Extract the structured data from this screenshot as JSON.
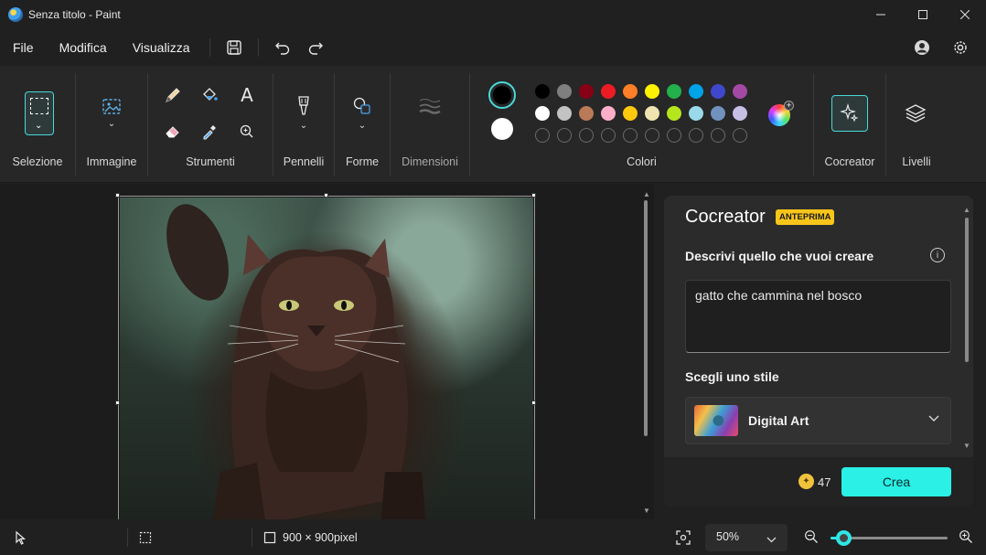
{
  "window": {
    "title": "Senza titolo - Paint"
  },
  "menu": {
    "file": "File",
    "edit": "Modifica",
    "view": "Visualizza"
  },
  "ribbon": {
    "selection_label": "Selezione",
    "image_label": "Immagine",
    "tools_label": "Strumenti",
    "brushes_label": "Pennelli",
    "shapes_label": "Forme",
    "size_label": "Dimensioni",
    "colors_label": "Colori",
    "cocreator_label": "Cocreator",
    "layers_label": "Livelli",
    "text_tool_glyph": "A"
  },
  "colors": {
    "primary": "#000000",
    "secondary": "#ffffff",
    "row1": [
      "#000000",
      "#7f7f7f",
      "#880015",
      "#ed1c24",
      "#ff7f27",
      "#fff200",
      "#22b14c",
      "#00a2e8",
      "#3f48cc",
      "#a349a4"
    ],
    "row2": [
      "#ffffff",
      "#c3c3c3",
      "#b97a57",
      "#ffaec9",
      "#ffc90e",
      "#efe4b0",
      "#b5e61d",
      "#99d9ea",
      "#7092be",
      "#c8bfe7"
    ],
    "accent": "#2af0e6"
  },
  "cocreator": {
    "title": "Cocreator",
    "badge": "ANTEPRIMA",
    "describe_label": "Descrivi quello che vuoi creare",
    "info_glyph": "i",
    "prompt": "gatto che cammina nel bosco",
    "style_label": "Scegli uno stile",
    "style_value": "Digital Art",
    "credits": "47",
    "create_label": "Crea"
  },
  "status": {
    "canvas_size": "900 × 900pixel",
    "zoom": "50%",
    "zoom_slider_fraction": 0.11
  }
}
